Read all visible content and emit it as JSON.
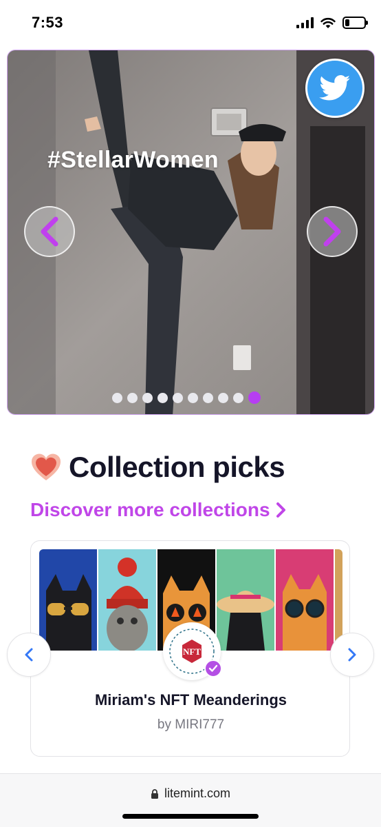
{
  "status_bar": {
    "time": "7:53",
    "battery_level": 0.22
  },
  "hero": {
    "hashtag": "#StellarWomen",
    "slide_count": 10,
    "active_slide": 10,
    "icons": {
      "share": "twitter-icon",
      "prev": "chevron-left-icon",
      "next": "chevron-right-icon"
    },
    "accent_color": "#b63ef2"
  },
  "collection_picks": {
    "title": "Collection picks",
    "discover_label": "Discover more collections",
    "card": {
      "name": "Miriam's NFT Meanderings",
      "creator": "by MIRI777",
      "logo_text": "NFT",
      "verified": true
    }
  },
  "browser": {
    "url": "litemint.com"
  },
  "colors": {
    "accent": "#c046e8",
    "twitter": "#3a9ef0",
    "verified": "#b44fe4",
    "heart": "#e86a5a"
  }
}
